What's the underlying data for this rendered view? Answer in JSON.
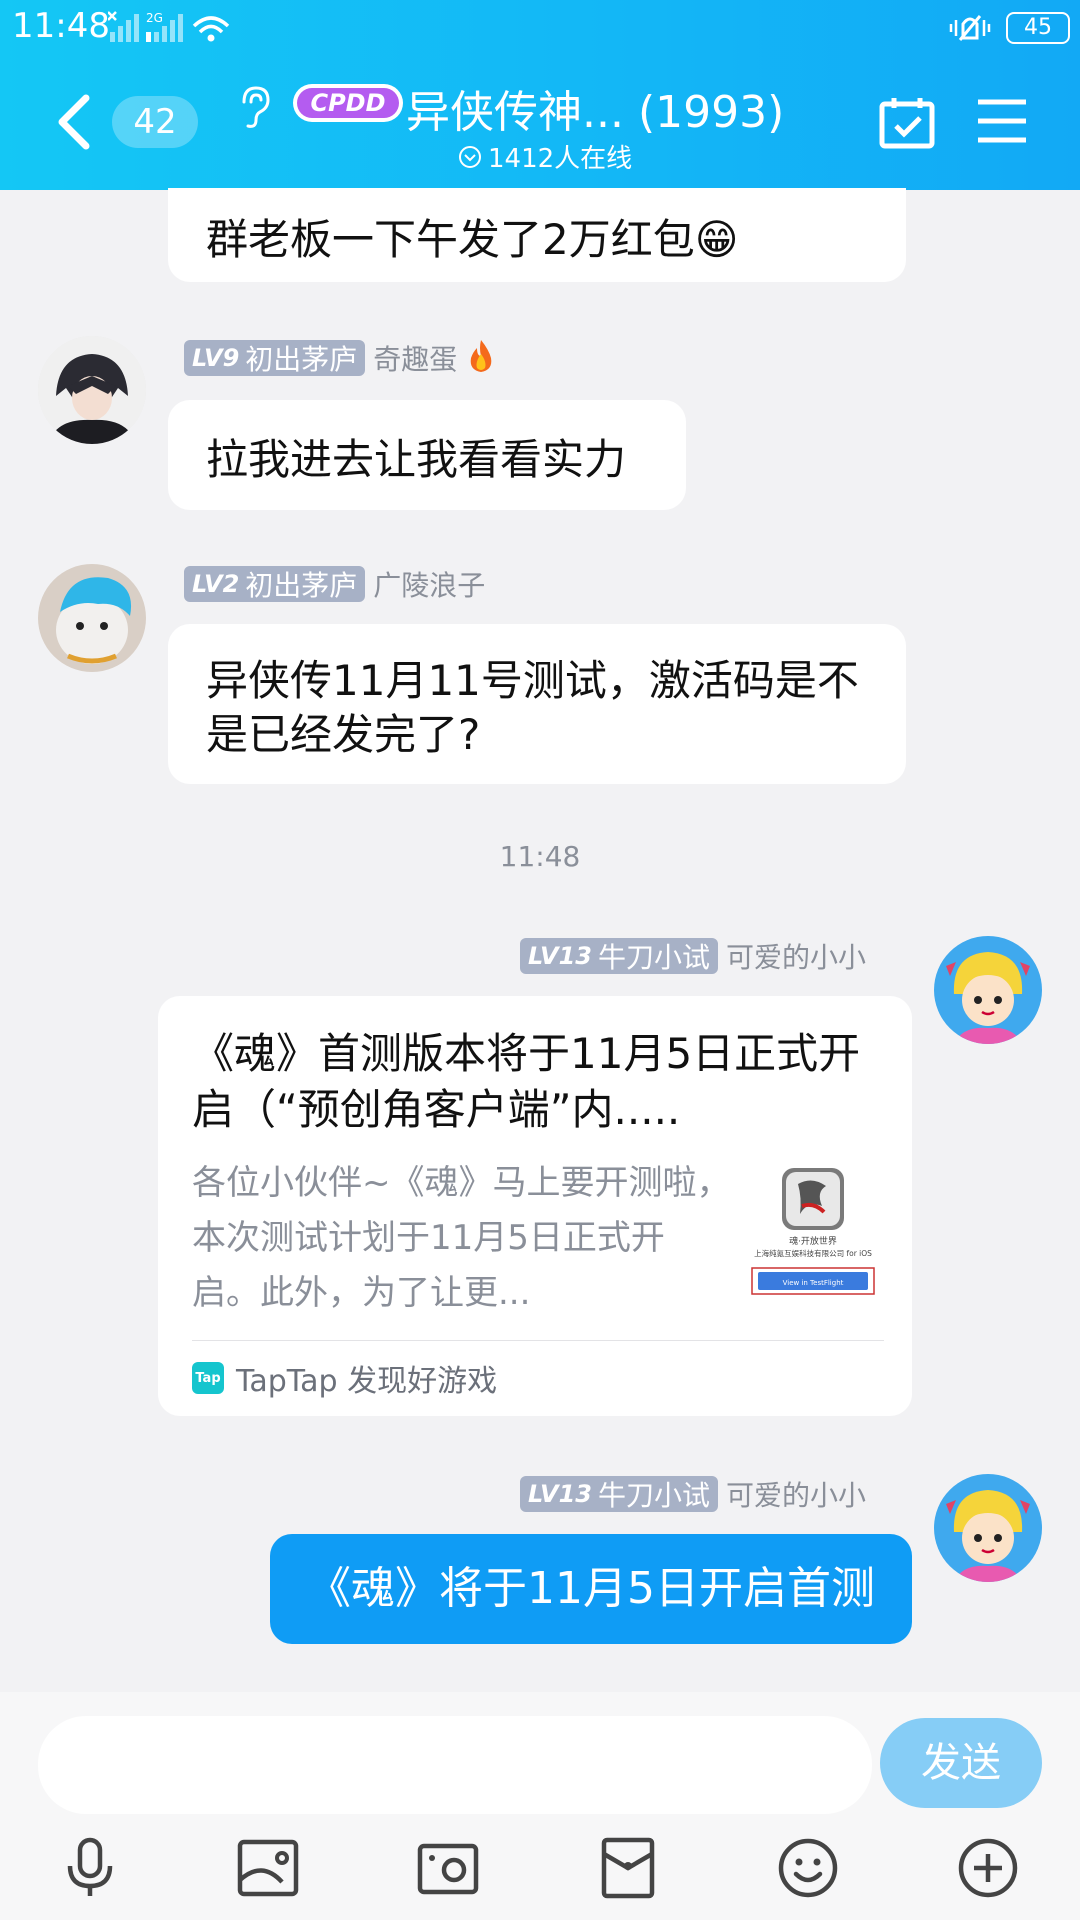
{
  "status_bar": {
    "time": "11:48",
    "network": "2G",
    "battery": "45"
  },
  "header": {
    "unread_count": "42",
    "group_tag": "CPDD",
    "title": "异侠传神... (1993)",
    "online": "1412人在线"
  },
  "messages": [
    {
      "text": "群老板一下午发了2万红包😁"
    },
    {
      "level": "LV9",
      "title": "初出茅庐",
      "nickname": "奇趣蛋",
      "text": "拉我进去让我看看实力"
    },
    {
      "level": "LV2",
      "title": "初出茅庐",
      "nickname": "广陵浪子",
      "text": "异侠传11月11号测试，激活码是不是已经发完了?"
    }
  ],
  "time_divider": "11:48",
  "card_message": {
    "level": "LV13",
    "title": "牛刀小试",
    "nickname": "可爱的小小",
    "card_title": "《魂》首测版本将于11月5日正式开启（“预创角客户端”内.....",
    "card_desc": "各位小伙伴~《魂》马上要开测啦，本次测试计划于11月5日正式开启。此外，为了让更...",
    "thumb_caption": "魂·开放世界",
    "thumb_company": "上海纯氪互娱科技有限公司 for iOS",
    "thumb_button": "View in TestFlight",
    "source": "TapTap 发现好游戏",
    "source_logo": "Tap"
  },
  "self_message": {
    "level": "LV13",
    "title": "牛刀小试",
    "nickname": "可爱的小小",
    "text": "《魂》将于11月5日开启首测"
  },
  "input": {
    "placeholder": "",
    "send_label": "发送"
  },
  "toolbar_icons": [
    "microphone-icon",
    "image-icon",
    "camera-icon",
    "red-packet-icon",
    "emoji-icon",
    "plus-icon"
  ],
  "colors": {
    "header": "#14c7f5",
    "self_bubble": "#0f9cf5",
    "send_button": "#86cdf6",
    "level_tag": "#a7b1c6"
  }
}
